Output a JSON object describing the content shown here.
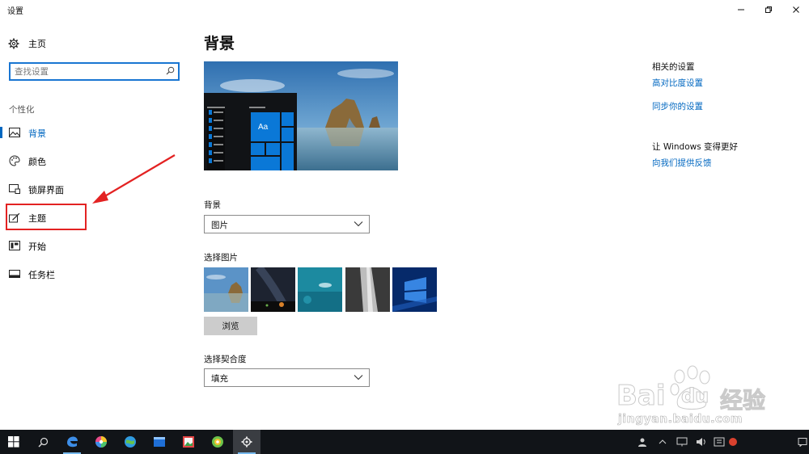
{
  "window": {
    "title": "设置",
    "controls": {
      "minimize": "—",
      "maximize": "❐",
      "close": "✕"
    }
  },
  "sidebar": {
    "home_label": "主页",
    "search_placeholder": "查找设置",
    "group_label": "个性化",
    "items": [
      {
        "label": "背景",
        "icon": "image-icon",
        "active": true
      },
      {
        "label": "颜色",
        "icon": "palette-icon",
        "active": false
      },
      {
        "label": "锁屏界面",
        "icon": "lock-screen-icon",
        "active": false
      },
      {
        "label": "主题",
        "icon": "theme-brush-icon",
        "active": false
      },
      {
        "label": "开始",
        "icon": "start-menu-icon",
        "active": false
      },
      {
        "label": "任务栏",
        "icon": "taskbar-icon",
        "active": false
      }
    ]
  },
  "main": {
    "page_title": "背景",
    "preview_tile_text": "Aa",
    "background_label": "背景",
    "background_value": "图片",
    "choose_picture_label": "选择图片",
    "browse_label": "浏览",
    "fit_label": "选择契合度",
    "fit_value": "填充"
  },
  "related": {
    "heading": "相关的设置",
    "links": [
      "高对比度设置",
      "同步你的设置"
    ],
    "feedback_heading": "让 Windows 变得更好",
    "feedback_link": "向我们提供反馈"
  },
  "watermark": {
    "text_left": "Bai",
    "text_du": "du",
    "text_cn": "经验",
    "url": "jingyan.baidu.com"
  },
  "colors": {
    "accent": "#0067c0",
    "annotation_red": "#e32222",
    "taskbar": "#111418"
  }
}
